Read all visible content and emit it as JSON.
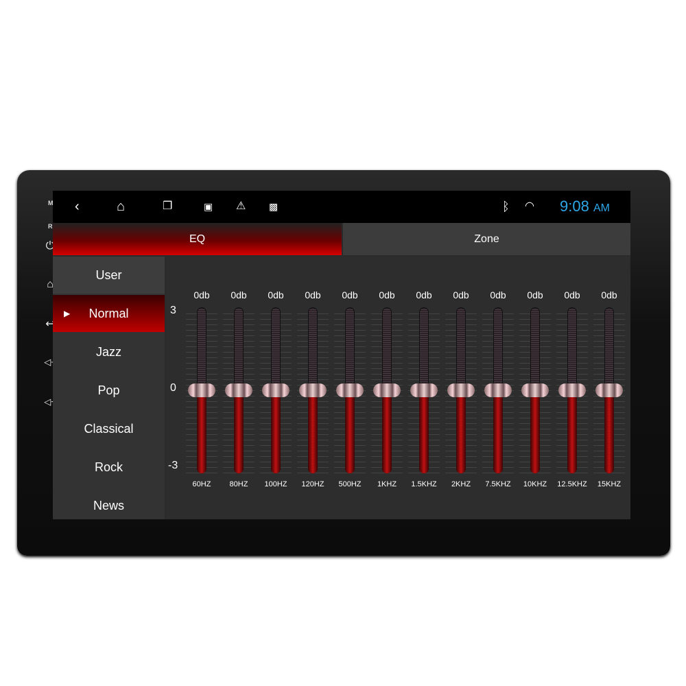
{
  "device": {
    "labels": {
      "mic": "MIC",
      "rst": "RST"
    },
    "side_icons": [
      "power-icon",
      "home-icon",
      "back-icon",
      "volume-up-icon",
      "volume-down-icon"
    ]
  },
  "statusbar": {
    "icons": [
      "back-icon",
      "home-icon",
      "recent-apps-icon",
      "image-icon",
      "warning-icon",
      "activity-icon"
    ],
    "time": "9:08",
    "ampm": "AM",
    "clock_color": "#2ea7e8"
  },
  "tabs": [
    {
      "label": "EQ",
      "active": true
    },
    {
      "label": "Zone",
      "active": false
    }
  ],
  "presets": [
    {
      "label": "User"
    },
    {
      "label": "Normal",
      "selected": true
    },
    {
      "label": "Jazz"
    },
    {
      "label": "Pop"
    },
    {
      "label": "Classical"
    },
    {
      "label": "Rock"
    },
    {
      "label": "News"
    }
  ],
  "scale": {
    "max": "3",
    "mid": "0",
    "min": "-3"
  },
  "bands": [
    {
      "freq": "60HZ",
      "db_label": "0db",
      "value": 0
    },
    {
      "freq": "80HZ",
      "db_label": "0db",
      "value": 0
    },
    {
      "freq": "100HZ",
      "db_label": "0db",
      "value": 0
    },
    {
      "freq": "120HZ",
      "db_label": "0db",
      "value": 0
    },
    {
      "freq": "500HZ",
      "db_label": "0db",
      "value": 0
    },
    {
      "freq": "1KHZ",
      "db_label": "0db",
      "value": 0
    },
    {
      "freq": "1.5KHZ",
      "db_label": "0db",
      "value": 0
    },
    {
      "freq": "2KHZ",
      "db_label": "0db",
      "value": 0
    },
    {
      "freq": "7.5KHZ",
      "db_label": "0db",
      "value": 0
    },
    {
      "freq": "10KHZ",
      "db_label": "0db",
      "value": 0
    },
    {
      "freq": "12.5KHZ",
      "db_label": "0db",
      "value": 0
    },
    {
      "freq": "15KHZ",
      "db_label": "0db",
      "value": 0
    }
  ],
  "accent": "#d40000"
}
